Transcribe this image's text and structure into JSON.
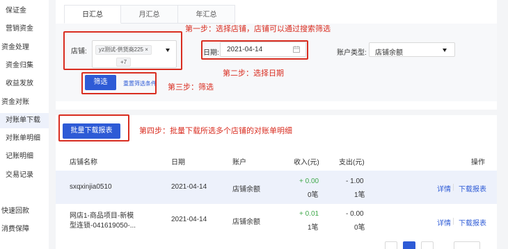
{
  "sidebar": {
    "items": [
      {
        "label": "保证金"
      },
      {
        "label": "营销资金"
      },
      {
        "label": "资金处理"
      },
      {
        "label": "资金归集"
      },
      {
        "label": "收益发放"
      },
      {
        "label": "资金对账"
      },
      {
        "label": "对账单下载"
      },
      {
        "label": "对账单明细"
      },
      {
        "label": "记账明细"
      },
      {
        "label": "交易记录"
      },
      {
        "label": "快速回款"
      },
      {
        "label": "消费保障"
      }
    ]
  },
  "tabs": [
    {
      "label": "日汇总"
    },
    {
      "label": "月汇总"
    },
    {
      "label": "年汇总"
    }
  ],
  "filters": {
    "store_label": "店铺:",
    "store_chip": "yz测试-供货商225",
    "store_chip_close": "×",
    "store_more": "+7",
    "date_label": "日期:",
    "date_value": "2021-04-14",
    "account_label": "账户类型:",
    "account_value": "店铺余额",
    "filter_button": "筛选",
    "reset_link": "重置筛选条件"
  },
  "batch_button": "批量下载报表",
  "annotations": {
    "step1": "第一步：选择店铺，店铺可以通过搜索筛选",
    "step2": "第二步：选择日期",
    "step3": "第三步：筛选",
    "step4": "第四步：批量下载所选多个店铺的对账单明细"
  },
  "table": {
    "headers": {
      "store": "店铺名称",
      "date": "日期",
      "account": "账户",
      "income": "收入(元)",
      "expense": "支出(元)",
      "ops": "操作"
    },
    "rows": [
      {
        "store_line1": "sxqxinjia0510",
        "store_line2": "",
        "date": "2021-04-14",
        "account": "店铺余额",
        "income": "+ 0.00",
        "income_count": "0笔",
        "expense": "- 1.00",
        "expense_count": "1笔",
        "detail": "详情",
        "download": "下载报表"
      },
      {
        "store_line1": "网店1-商品项目-新模",
        "store_line2": "型连锁-041619050-...",
        "date": "2021-04-14",
        "account": "店铺余额",
        "income": "+ 0.01",
        "income_count": "1笔",
        "expense": "- 0.00",
        "expense_count": "0笔",
        "detail": "详情",
        "download": "下载报表"
      }
    ]
  },
  "colors": {
    "primary": "#2e5bd6",
    "annotation_red": "#d92d20",
    "income_green": "#3fa84a"
  }
}
